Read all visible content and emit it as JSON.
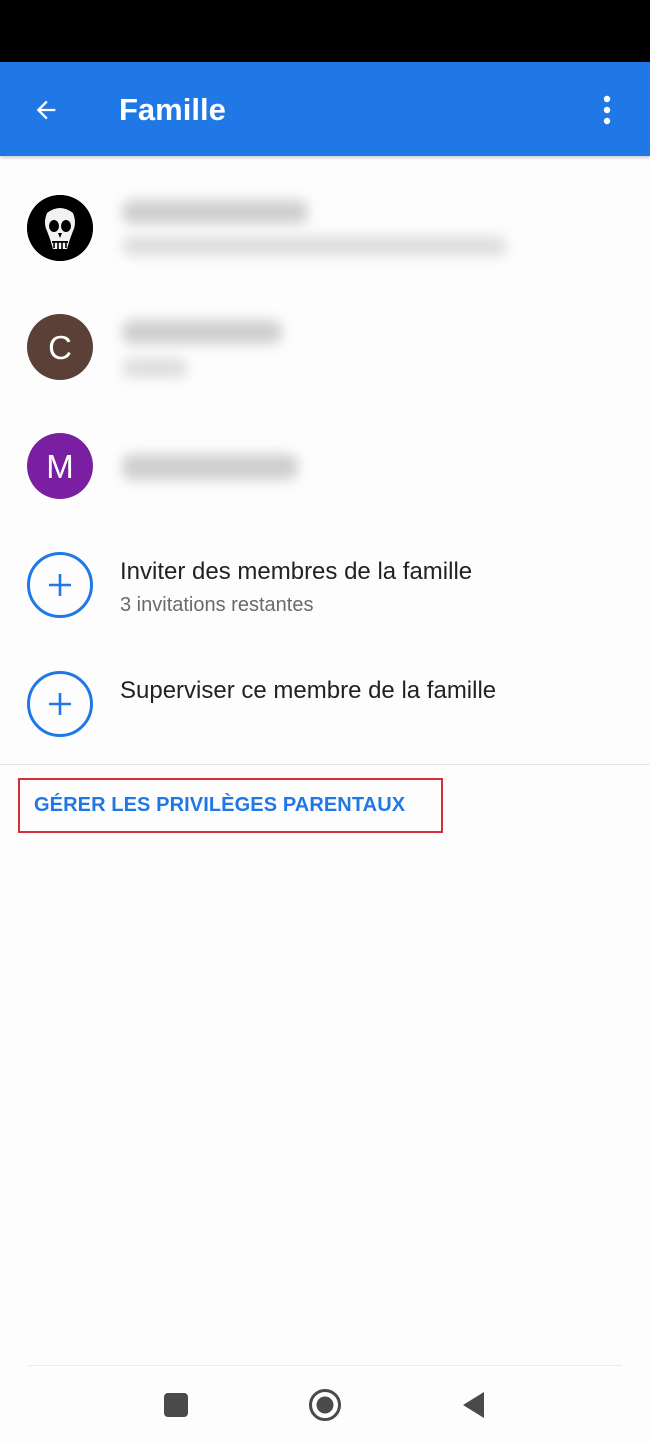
{
  "app_bar": {
    "title": "Famille",
    "back_icon": "arrow-back-icon",
    "menu_icon": "more-vert-icon",
    "color": "#1f78e6"
  },
  "members": [
    {
      "avatar_type": "image",
      "avatar_icon": "skull-avatar",
      "avatar_color": "#000000",
      "name": "",
      "detail": ""
    },
    {
      "avatar_type": "letter",
      "avatar_letter": "C",
      "avatar_color": "#5b4038",
      "name": "",
      "detail": ""
    },
    {
      "avatar_type": "letter",
      "avatar_letter": "M",
      "avatar_color": "#7b1fa2",
      "name": ""
    }
  ],
  "actions": {
    "invite": {
      "icon": "plus-circle-icon",
      "title": "Inviter des membres de la famille",
      "subtitle": "3 invitations restantes"
    },
    "supervise": {
      "icon": "plus-circle-icon",
      "title": "Superviser ce membre de la famille"
    }
  },
  "manage_button": {
    "label": "GÉRER LES PRIVILÈGES PARENTAUX",
    "highlight_color": "#d32f3c"
  },
  "nav_bar": {
    "recents_icon": "square-recents-icon",
    "home_icon": "circle-home-icon",
    "back_icon": "triangle-back-icon"
  }
}
